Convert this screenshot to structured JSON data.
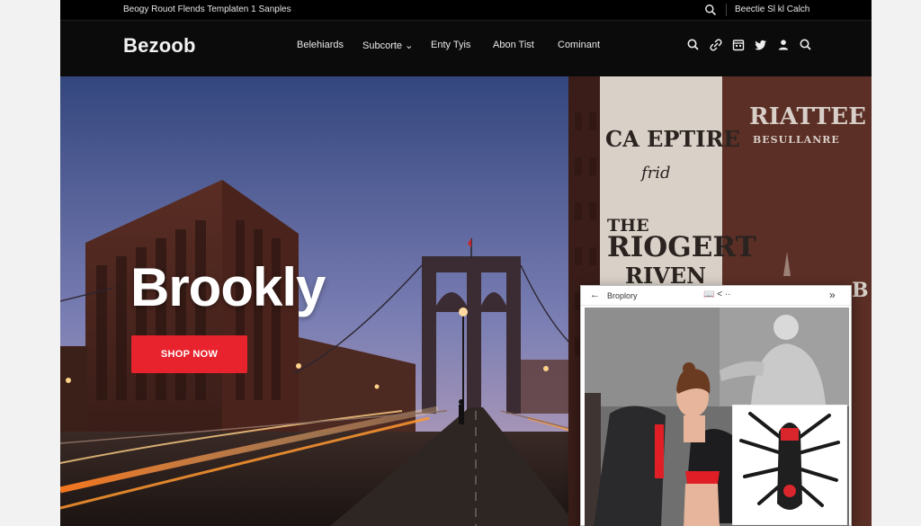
{
  "topbar": {
    "promo_text": "Beogy Rouot Flends Templaten 1 Sanples",
    "account_text": "Beectie Sl kl Calch",
    "icons": [
      "search-icon"
    ]
  },
  "navbar": {
    "logo": "Bezoob",
    "items": [
      {
        "label": "Belehiards"
      },
      {
        "label": "Subcorte ⌄"
      },
      {
        "label": "Enty Tyis"
      },
      {
        "label": "Abon Tist"
      },
      {
        "label": "Cominant"
      }
    ],
    "icons": [
      "search-icon",
      "link-icon",
      "calendar-icon",
      "twitter-icon",
      "user-icon",
      "search-icon"
    ]
  },
  "hero": {
    "title": "Brookly",
    "cta_label": "SHOP NOW",
    "billboard": {
      "line1": "CA EPTIRE",
      "line2": "frid",
      "line3": "THE",
      "line4": "RIOGERT",
      "line5": "RIVEN",
      "sign1": "RIATTEE",
      "sign2": "BESULLANRE",
      "sign3": "B"
    }
  },
  "popup": {
    "back": "←",
    "title": "Broplory",
    "controls": "📖 < ··",
    "expand": "»"
  },
  "colors": {
    "accent": "#e8232e",
    "nav_bg": "#0b0b0b",
    "sky_top": "#3b4f86",
    "sky_bottom": "#b79bbd"
  }
}
